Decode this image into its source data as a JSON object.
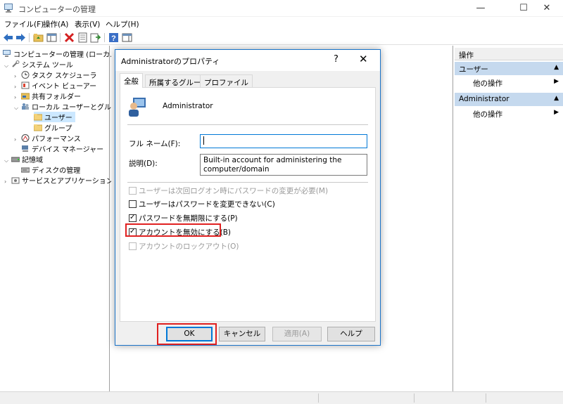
{
  "window": {
    "title": "コンピューターの管理",
    "minimize_glyph": "—",
    "maximize_glyph": "☐",
    "close_glyph": "✕"
  },
  "menu": {
    "items": [
      "ファイル(F)",
      "操作(A)",
      "表示(V)",
      "ヘルプ(H)"
    ]
  },
  "toolbar": {
    "icons": [
      "back-arrow-icon",
      "forward-arrow-icon",
      "up-folder-icon",
      "show-hide-tree-icon",
      "delete-icon",
      "properties-icon",
      "export-icon",
      "help-icon",
      "action-pane-icon"
    ]
  },
  "tree": {
    "items": [
      {
        "label": "コンピューターの管理 (ローカル)",
        "icon": "computer-icon",
        "arrow": ""
      },
      {
        "label": "システム ツール",
        "icon": "tools-icon",
        "arrow": "⌵"
      },
      {
        "label": "タスク スケジューラ",
        "icon": "clock-icon",
        "arrow": "›"
      },
      {
        "label": "イベント ビューアー",
        "icon": "event-viewer-icon",
        "arrow": "›"
      },
      {
        "label": "共有フォルダー",
        "icon": "shared-folder-icon",
        "arrow": "›"
      },
      {
        "label": "ローカル ユーザーとグループ",
        "icon": "users-group-icon",
        "arrow": "⌵"
      },
      {
        "label": "ユーザー",
        "icon": "folder-icon",
        "arrow": ""
      },
      {
        "label": "グループ",
        "icon": "folder-icon",
        "arrow": ""
      },
      {
        "label": "パフォーマンス",
        "icon": "performance-icon",
        "arrow": "›"
      },
      {
        "label": "デバイス マネージャー",
        "icon": "device-manager-icon",
        "arrow": ""
      },
      {
        "label": "記憶域",
        "icon": "storage-icon",
        "arrow": "⌵"
      },
      {
        "label": "ディスクの管理",
        "icon": "disk-icon",
        "arrow": ""
      },
      {
        "label": "サービスとアプリケーション",
        "icon": "services-icon",
        "arrow": "›"
      }
    ],
    "selected": "ユーザー"
  },
  "actions": {
    "header": "操作",
    "sections": [
      {
        "title": "ユーザー",
        "item": "他の操作"
      },
      {
        "title": "Administrator",
        "item": "他の操作"
      }
    ]
  },
  "dialog": {
    "title": "Administratorのプロパティ",
    "help_glyph": "?",
    "close_glyph": "✕",
    "tabs": [
      "全般",
      "所属するグループ",
      "プロファイル"
    ],
    "active_tab": "全般",
    "user_name": "Administrator",
    "full_name_label": "フル ネーム(F):",
    "full_name_value": "",
    "description_label": "説明(D):",
    "description_value_line1": "Built-in account for administering the",
    "description_value_line2": "computer/domain",
    "checkboxes": [
      {
        "label": "ユーザーは次回ログオン時にパスワードの変更が必要(M)",
        "checked": false,
        "enabled": false
      },
      {
        "label": "ユーザーはパスワードを変更できない(C)",
        "checked": false,
        "enabled": true
      },
      {
        "label": "パスワードを無期限にする(P)",
        "checked": true,
        "enabled": true
      },
      {
        "label": "アカウントを無効にする(B)",
        "checked": true,
        "enabled": true
      },
      {
        "label": "アカウントのロックアウト(O)",
        "checked": false,
        "enabled": false
      }
    ],
    "check_mark": "✓",
    "buttons": {
      "ok": "OK",
      "cancel": "キャンセル",
      "apply": "適用(A)",
      "help": "ヘルプ"
    },
    "highlight_color": "#e02020"
  }
}
